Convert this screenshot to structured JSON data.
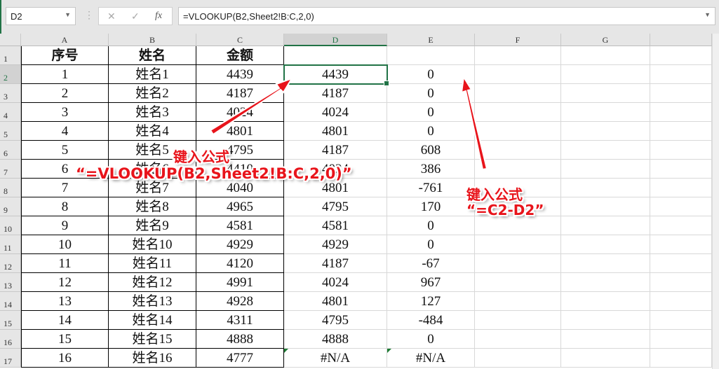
{
  "formula_bar": {
    "name_box": "D2",
    "cancel_icon": "✕",
    "enter_icon": "✓",
    "fx_label": "fx",
    "formula": "=VLOOKUP(B2,Sheet2!B:C,2,0)"
  },
  "columns": [
    "A",
    "B",
    "C",
    "D",
    "E",
    "F",
    "G"
  ],
  "selected_cell": "D2",
  "header_row": [
    "序号",
    "姓名",
    "金额",
    ""
  ],
  "rows": [
    [
      "1",
      "姓名1",
      "4439",
      "4439",
      "0"
    ],
    [
      "2",
      "姓名2",
      "4187",
      "4187",
      "0"
    ],
    [
      "3",
      "姓名3",
      "4024",
      "4024",
      "0"
    ],
    [
      "4",
      "姓名4",
      "4801",
      "4801",
      "0"
    ],
    [
      "5",
      "姓名5",
      "4795",
      "4187",
      "608"
    ],
    [
      "6",
      "姓名6",
      "4410",
      "4024",
      "386"
    ],
    [
      "7",
      "姓名7",
      "4040",
      "4801",
      "-761"
    ],
    [
      "8",
      "姓名8",
      "4965",
      "4795",
      "170"
    ],
    [
      "9",
      "姓名9",
      "4581",
      "4581",
      "0"
    ],
    [
      "10",
      "姓名10",
      "4929",
      "4929",
      "0"
    ],
    [
      "11",
      "姓名11",
      "4120",
      "4187",
      "-67"
    ],
    [
      "12",
      "姓名12",
      "4991",
      "4024",
      "967"
    ],
    [
      "13",
      "姓名13",
      "4928",
      "4801",
      "127"
    ],
    [
      "14",
      "姓名14",
      "4311",
      "4795",
      "-484"
    ],
    [
      "15",
      "姓名15",
      "4888",
      "4888",
      "0"
    ],
    [
      "16",
      "姓名16",
      "4777",
      "#N/A",
      "#N/A"
    ]
  ],
  "annotations": {
    "d_title": "键入公式",
    "d_formula": "“=VLOOKUP(B2,Sheet2!B:C,2,0)”",
    "e_title": "键入公式",
    "e_formula": "“=C2-D2”"
  },
  "colors": {
    "accent": "#217346",
    "annotation": "#e8141b"
  }
}
